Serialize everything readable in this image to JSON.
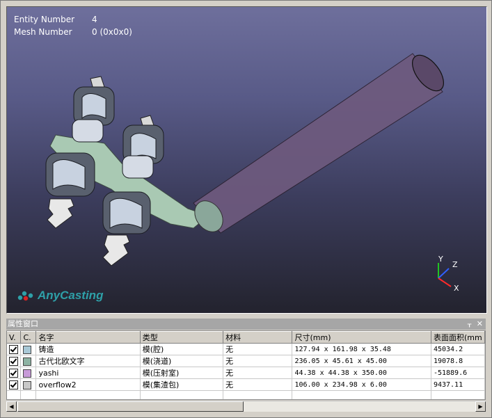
{
  "viewport": {
    "entity_label": "Entity Number",
    "entity_value": "4",
    "mesh_label": "Mesh Number",
    "mesh_value": "0 (0x0x0)",
    "brand": "AnyCasting",
    "axes": {
      "y": "Y",
      "z": "Z",
      "x": "X"
    },
    "colors": {
      "runner": "#a9c9b3",
      "cavity": "#d5dbe5",
      "sprue": "#7a5f86"
    }
  },
  "panel": {
    "title": "属性窗口",
    "pin_icon": "pin-icon",
    "close_icon": "close-icon",
    "pin_glyph": "ᚁ",
    "close_glyph": "✕",
    "columns": [
      "V.",
      "C.",
      "名字",
      "类型",
      "材料",
      "尺寸(mm)",
      "表面面积(mm"
    ],
    "rows": [
      {
        "visible": true,
        "color": "#a8c8d6",
        "name": "铸造",
        "type": "模(腔)",
        "material": "无",
        "size": "127.94 x 161.98 x 35.48",
        "area": "45034.2"
      },
      {
        "visible": true,
        "color": "#8db3a3",
        "name": "古代北欧文字",
        "type": "模(浇道)",
        "material": "无",
        "size": "236.05 x 45.61 x 45.00",
        "area": "19078.8"
      },
      {
        "visible": true,
        "color": "#c79ad8",
        "name": "yashi",
        "type": "模(压射室)",
        "material": "无",
        "size": "44.38 x 44.38 x 350.00",
        "area": "-51889.6"
      },
      {
        "visible": true,
        "color": "#c8c8c8",
        "name": "overflow2",
        "type": "模(集渣包)",
        "material": "无",
        "size": "106.00 x 234.98 x 6.00",
        "area": "9437.11"
      }
    ]
  }
}
